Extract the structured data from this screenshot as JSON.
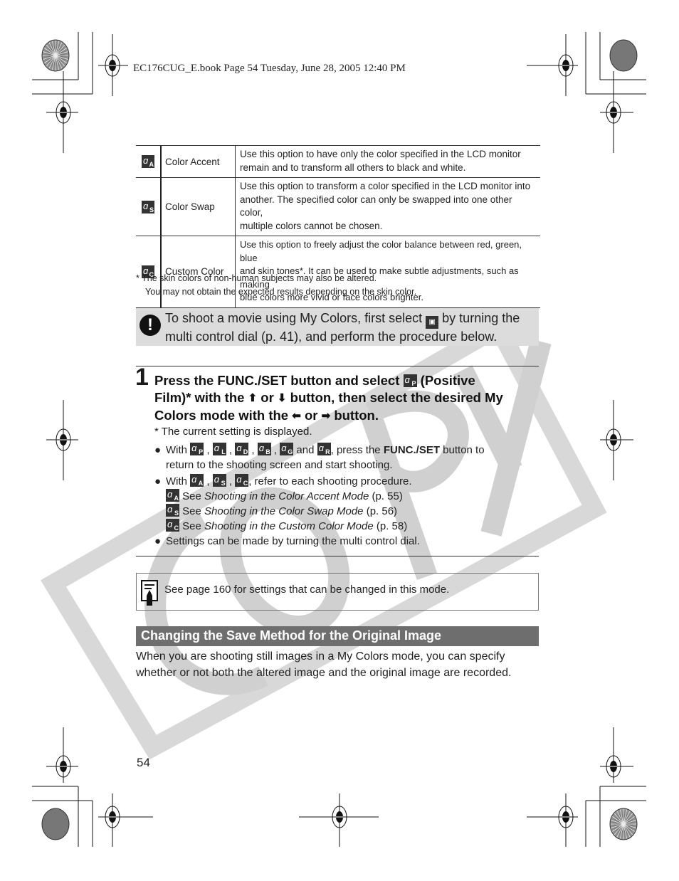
{
  "header": {
    "print_line": "EC176CUG_E.book  Page 54  Tuesday, June 28, 2005  12:40 PM"
  },
  "watermark": {
    "text": "COPY"
  },
  "mode_table": {
    "rows": [
      {
        "icon": "color-accent-icon",
        "icon_sub": "A",
        "name": "Color Accent",
        "lines": [
          "Use this option to have only the color specified in the LCD monitor",
          "remain and to transform all others to black and white."
        ]
      },
      {
        "icon": "color-swap-icon",
        "icon_sub": "S",
        "name": "Color Swap",
        "lines": [
          "Use this option to transform a color specified in the LCD monitor into",
          "another. The specified color can only be swapped into one other color,",
          "multiple colors cannot be chosen."
        ]
      },
      {
        "icon": "custom-color-icon",
        "icon_sub": "C",
        "name": "Custom Color",
        "lines": [
          "Use this option to freely adjust the color balance between red, green, blue",
          "and skin tones*. It can be used to make subtle adjustments, such as making",
          "blue colors more vivid or face colors brighter."
        ]
      }
    ]
  },
  "footnote": {
    "line1": "*  The skin colors of non-human subjects may also be altered.",
    "line2": "You may not obtain the expected results depending on the skin color."
  },
  "caution": {
    "icon": "caution-icon",
    "text_before": "To shoot a movie using My Colors, first select",
    "text_after": "by turning the",
    "line2": "multi control dial (p. 41), and perform the procedure below."
  },
  "step": {
    "number": "1",
    "p1": "Press the FUNC./SET button and select",
    "p1_icon_sub": "P",
    "p2": "(Positive",
    "p3": "Film)* with the",
    "or1": "or",
    "p4": "button, then select the desired My",
    "p5": "Colors mode with the",
    "or2": "or",
    "p6": "button.",
    "note": "*  The current setting is displayed."
  },
  "bullets": {
    "b1_with": "With",
    "b1_icons": [
      "P",
      "L",
      "D",
      "B",
      "G"
    ],
    "b1_and": "and",
    "b1_last_icon": "R",
    "b1_press": ", press the",
    "b1_bold": "FUNC./SET",
    "b1_rest": "button to",
    "b1_line2": "return to the shooting screen and start shooting.",
    "b2_with": "With",
    "b2_icons": [
      "A",
      "S",
      "C"
    ],
    "b2_rest": ", refer to each shooting procedure.",
    "refs": [
      {
        "icon_sub": "A",
        "see": "See",
        "title": "Shooting in the Color Accent Mode",
        "page": "(p. 55)"
      },
      {
        "icon_sub": "S",
        "see": "See",
        "title": "Shooting in the Color Swap Mode",
        "page": "(p. 56)"
      },
      {
        "icon_sub": "C",
        "see": "See",
        "title": "Shooting in the Custom Color Mode",
        "page": "(p. 58)"
      }
    ],
    "b3": "Settings can be made by turning the multi control dial."
  },
  "memo": {
    "icon": "memo-icon",
    "text": "See page 160 for settings that can be changed in this mode."
  },
  "section": {
    "title": "Changing the Save Method for the Original Image",
    "body_line1": "When you are shooting still images in a My Colors mode, you can specify",
    "body_line2": "whether or not both the altered image and the original image are recorded."
  },
  "page_number": "54"
}
